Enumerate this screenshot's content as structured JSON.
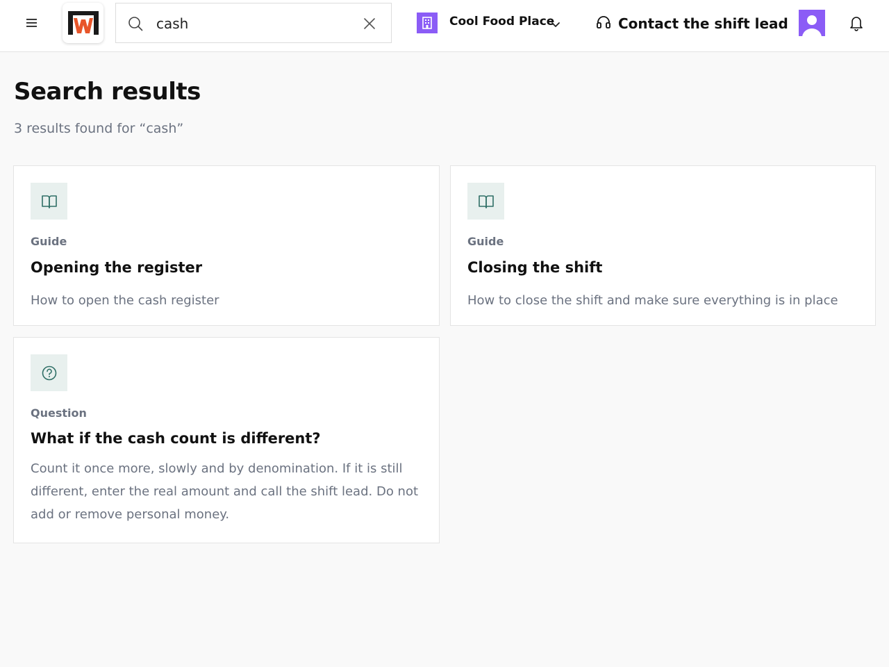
{
  "header": {
    "menu_icon": "hamburger-menu-icon",
    "logo_icon": "app-logo",
    "search": {
      "value": "cash",
      "placeholder": "Search"
    },
    "location": {
      "name": "Cool Food Place",
      "icon": "building-icon"
    },
    "contact_label": "Contact the shift lead",
    "contact_icon": "headset-icon",
    "notifications_icon": "bell-icon"
  },
  "main": {
    "title": "Search results",
    "results_summary": "3 results found for “cash”",
    "results": [
      {
        "type": "Guide",
        "icon": "book-icon",
        "title": "Opening the register",
        "description": "How to open the cash register"
      },
      {
        "type": "Guide",
        "icon": "book-icon",
        "title": "Closing the shift",
        "description": "How to close the shift and make sure everything is in place"
      },
      {
        "type": "Question",
        "icon": "question-circle-icon",
        "title": "What if the cash count is different?",
        "description": "Count it once more, slowly and by denomination. If it is still different, enter the real amount and call the shift lead. Do not add or remove personal money."
      }
    ]
  },
  "colors": {
    "accent_purple": "#8b5cf6",
    "icon_teal": "#2f6f66",
    "icon_bg": "#e8f0ee",
    "logo_orange": "#e8562a",
    "muted_text": "#6b7280"
  }
}
